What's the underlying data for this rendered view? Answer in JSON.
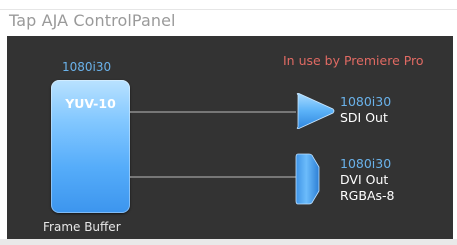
{
  "window": {
    "title": "Tap AJA ControlPanel"
  },
  "status": {
    "in_use": "In use by Premiere Pro"
  },
  "frame_buffer": {
    "format": "1080i30",
    "pixel_format": "YUV-10",
    "label": "Frame Buffer"
  },
  "outputs": {
    "sdi": {
      "format": "1080i30",
      "name": "SDI Out"
    },
    "dvi": {
      "format": "1080i30",
      "name": "DVI Out",
      "detail": "RGBAs-8"
    }
  },
  "colors": {
    "accent": "#6ab2ea",
    "warning": "#e06a63",
    "panel_bg": "#333333"
  },
  "icons": {
    "sdi": "sdi-output-triangle-icon",
    "dvi": "dvi-connector-icon"
  }
}
